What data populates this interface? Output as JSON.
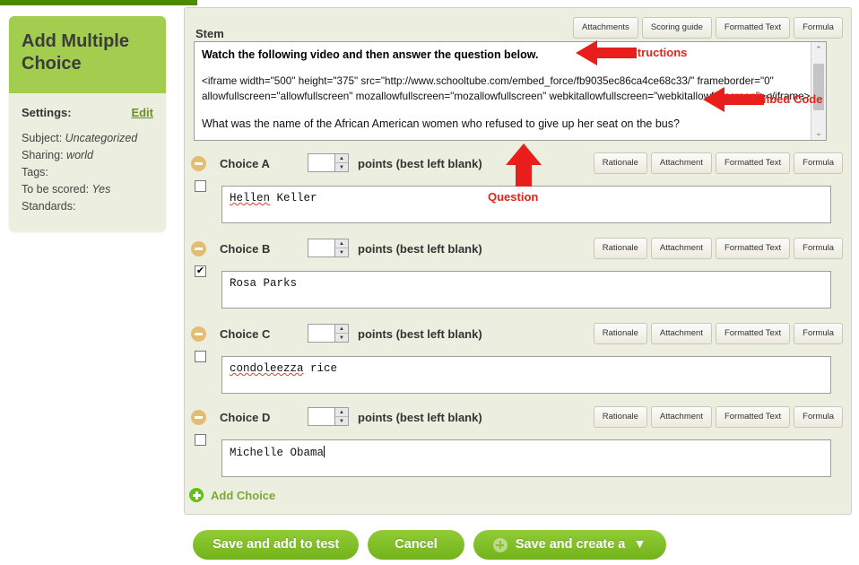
{
  "sidebar": {
    "title": "Add Multiple Choice",
    "settings_label": "Settings:",
    "edit_label": "Edit",
    "meta": [
      {
        "key": "Subject:",
        "value": "Uncategorized"
      },
      {
        "key": "Sharing:",
        "value": "world"
      },
      {
        "key": "Tags:",
        "value": ""
      },
      {
        "key": "To be scored:",
        "value": "Yes"
      },
      {
        "key": "Standards:",
        "value": ""
      }
    ]
  },
  "stem": {
    "label": "Stem",
    "toolbar": [
      "Attachments",
      "Scoring guide",
      "Formatted Text",
      "Formula"
    ],
    "instructions": "Watch the following video and then answer the question below.",
    "embed_code": "<iframe width=\"500\" height=\"375\" src=\"http://www.schooltube.com/embed_force/fb9035ec86ca4ce68c33/\" frameborder=\"0\" allowfullscreen=\"allowfullscreen\" mozallowfullscreen=\"mozallowfullscreen\" webkitallowfullscreen=\"webkitallowfullscreen\"></iframe>",
    "question": "What was the name of the African American women who refused to give up her seat on the bus?",
    "scroll_up_icon": "⌃",
    "scroll_down_icon": "⌄"
  },
  "choice_toolbar": [
    "Rationale",
    "Attachment",
    "Formatted Text",
    "Formula"
  ],
  "points_label": "points (best left blank)",
  "choices": [
    {
      "label": "Choice A",
      "points": "",
      "checked": false,
      "text": "Hellen Keller",
      "misspelled": "Hellen",
      "caret": false
    },
    {
      "label": "Choice B",
      "points": "",
      "checked": true,
      "text": "Rosa Parks",
      "misspelled": "",
      "caret": false
    },
    {
      "label": "Choice C",
      "points": "",
      "checked": false,
      "text": "condoleezza rice",
      "misspelled": "condoleezza",
      "caret": false
    },
    {
      "label": "Choice D",
      "points": "",
      "checked": false,
      "text": "Michelle Obama",
      "misspelled": "",
      "caret": true
    }
  ],
  "add_choice": {
    "label": "Add Choice",
    "icon": "plus-circle-icon"
  },
  "footer": {
    "save_add_label": "Save and add to test",
    "cancel_label": "Cancel",
    "save_create_label": "Save and create a",
    "dropdown_caret": "▼"
  },
  "annotations": [
    {
      "name": "instructions",
      "label": "Instructions",
      "arrow": "left"
    },
    {
      "name": "embed-code",
      "label": "Embed Code",
      "arrow": "left"
    },
    {
      "name": "question",
      "label": "Question",
      "arrow": "up"
    }
  ],
  "checkbox_check_glyph": "✔",
  "colors": {
    "brand_green": "#a2cd4e",
    "dark_green_bar": "#4e8a00",
    "panel_bg": "#ecefdf",
    "annotation_red": "#e8221c",
    "button_green": "#8fcc36",
    "minus_tan": "#e3bd74"
  }
}
